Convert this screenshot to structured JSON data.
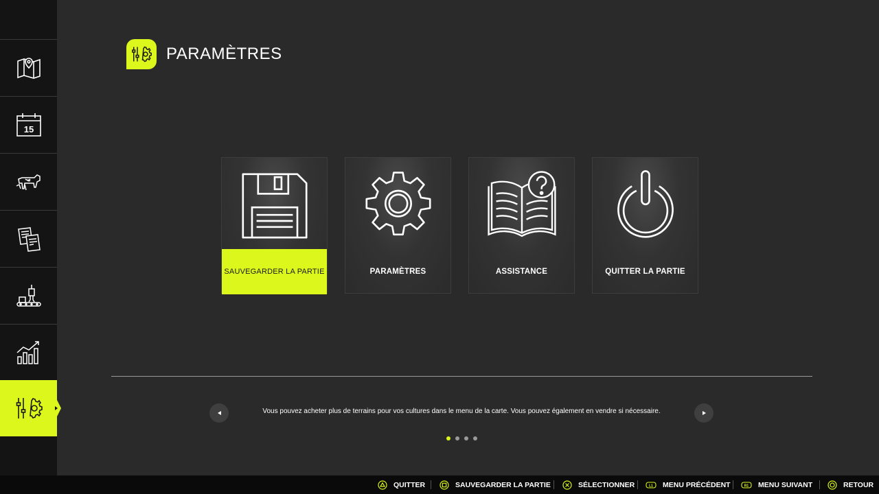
{
  "header": {
    "title": "PARAMÈTRES"
  },
  "sidebar": {
    "items": [
      {
        "icon": "map-icon"
      },
      {
        "icon": "calendar-icon",
        "calendar_day": "15"
      },
      {
        "icon": "animals-icon"
      },
      {
        "icon": "contracts-icon"
      },
      {
        "icon": "production-icon"
      },
      {
        "icon": "statistics-icon"
      },
      {
        "icon": "settings-icon",
        "active": true
      }
    ]
  },
  "menu": {
    "cards": [
      {
        "label": "SAUVEGARDER LA PARTIE",
        "icon": "save-icon",
        "selected": true
      },
      {
        "label": "PARAMÈTRES",
        "icon": "gear-icon",
        "selected": false
      },
      {
        "label": "ASSISTANCE",
        "icon": "help-book-icon",
        "selected": false
      },
      {
        "label": "QUITTER LA PARTIE",
        "icon": "power-icon",
        "selected": false
      }
    ]
  },
  "tip": {
    "text": "Vous pouvez acheter plus de terrains pour vos cultures dans le menu de la carte. Vous pouvez également en vendre si nécessaire.",
    "page": 1,
    "page_count": 4
  },
  "button_hints": [
    {
      "button": "triangle",
      "label": "QUITTER"
    },
    {
      "button": "square",
      "label": "SAUVEGARDER LA PARTIE"
    },
    {
      "button": "cross",
      "label": "SÉLECTIONNER"
    },
    {
      "button": "L1",
      "label": "MENU PRÉCÉDENT"
    },
    {
      "button": "R1",
      "label": "MENU SUIVANT"
    },
    {
      "button": "circle",
      "label": "RETOUR"
    }
  ],
  "colors": {
    "accent": "#dcf71c",
    "background": "#2a2a2a",
    "sidebar": "#141414"
  }
}
